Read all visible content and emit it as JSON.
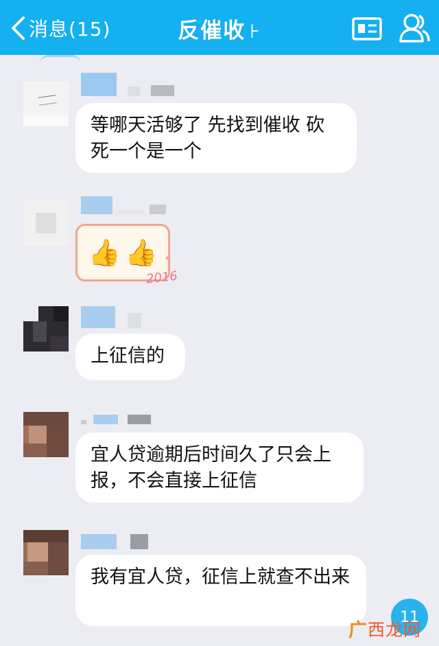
{
  "header": {
    "back_label": "消息(15)",
    "title": "反催收",
    "title_suffix": "⊦",
    "profile_icon": "profile-card-icon",
    "contacts_icon": "group-members-icon",
    "bg_color": "#14b0f0"
  },
  "messages": [
    {
      "text": "等哪天活够了 先找到催收 砍死一个是一个"
    },
    {
      "type": "sticker",
      "stickers": [
        "👍",
        "👍"
      ],
      "badge": "2016"
    },
    {
      "text": "上征信的"
    },
    {
      "text": "宜人贷逾期后时间久了只会上报，不会直接上征信"
    },
    {
      "text": "我有宜人贷，征信上就查不出来"
    }
  ],
  "unread_count": "11",
  "watermark": {
    "mark": "广",
    "rest": "西龙网"
  }
}
